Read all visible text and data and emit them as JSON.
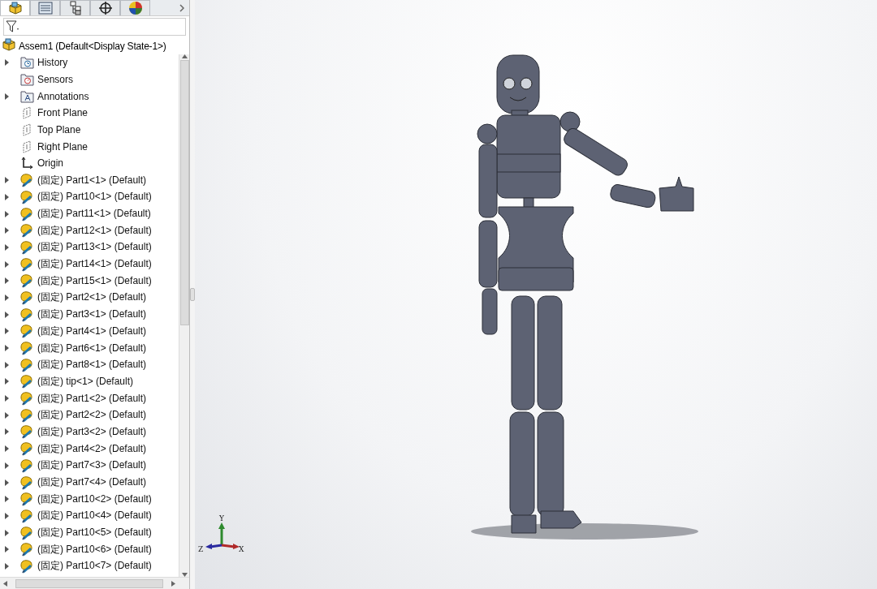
{
  "panel_tabs": [
    {
      "kind": "feature",
      "selected": true
    },
    {
      "kind": "property",
      "selected": false
    },
    {
      "kind": "config",
      "selected": false
    },
    {
      "kind": "dimxpert",
      "selected": false
    },
    {
      "kind": "display",
      "selected": false
    }
  ],
  "root": {
    "label": "Assem1  (Default<Display State-1>)"
  },
  "tree": [
    {
      "kind": "history",
      "label": "History",
      "expandable": true
    },
    {
      "kind": "sensors",
      "label": "Sensors",
      "expandable": false
    },
    {
      "kind": "annotations",
      "label": "Annotations",
      "expandable": true
    },
    {
      "kind": "plane",
      "label": "Front Plane",
      "expandable": false
    },
    {
      "kind": "plane",
      "label": "Top Plane",
      "expandable": false
    },
    {
      "kind": "plane",
      "label": "Right Plane",
      "expandable": false
    },
    {
      "kind": "origin",
      "label": "Origin",
      "expandable": false
    },
    {
      "kind": "part",
      "label": "(固定) Part1<1> (Default)",
      "expandable": true
    },
    {
      "kind": "part",
      "label": "(固定) Part10<1> (Default)",
      "expandable": true
    },
    {
      "kind": "part",
      "label": "(固定) Part11<1> (Default)",
      "expandable": true
    },
    {
      "kind": "part",
      "label": "(固定) Part12<1> (Default)",
      "expandable": true
    },
    {
      "kind": "part",
      "label": "(固定) Part13<1> (Default)",
      "expandable": true
    },
    {
      "kind": "part",
      "label": "(固定) Part14<1> (Default)",
      "expandable": true
    },
    {
      "kind": "part",
      "label": "(固定) Part15<1> (Default)",
      "expandable": true
    },
    {
      "kind": "part",
      "label": "(固定) Part2<1> (Default)",
      "expandable": true
    },
    {
      "kind": "part",
      "label": "(固定) Part3<1> (Default)",
      "expandable": true
    },
    {
      "kind": "part",
      "label": "(固定) Part4<1> (Default)",
      "expandable": true
    },
    {
      "kind": "part",
      "label": "(固定) Part6<1> (Default)",
      "expandable": true
    },
    {
      "kind": "part",
      "label": "(固定) Part8<1> (Default)",
      "expandable": true
    },
    {
      "kind": "part",
      "label": "(固定) tip<1> (Default)",
      "expandable": true
    },
    {
      "kind": "part",
      "label": "(固定) Part1<2> (Default)",
      "expandable": true
    },
    {
      "kind": "part",
      "label": "(固定) Part2<2> (Default)",
      "expandable": true
    },
    {
      "kind": "part",
      "label": "(固定) Part3<2> (Default)",
      "expandable": true
    },
    {
      "kind": "part",
      "label": "(固定) Part4<2> (Default)",
      "expandable": true
    },
    {
      "kind": "part",
      "label": "(固定) Part7<3> (Default)",
      "expandable": true
    },
    {
      "kind": "part",
      "label": "(固定) Part7<4> (Default)",
      "expandable": true
    },
    {
      "kind": "part",
      "label": "(固定) Part10<2> (Default)",
      "expandable": true
    },
    {
      "kind": "part",
      "label": "(固定) Part10<4> (Default)",
      "expandable": true
    },
    {
      "kind": "part",
      "label": "(固定) Part10<5> (Default)",
      "expandable": true
    },
    {
      "kind": "part",
      "label": "(固定) Part10<6> (Default)",
      "expandable": true
    },
    {
      "kind": "part",
      "label": "(固定) Part10<7> (Default)",
      "expandable": true
    }
  ],
  "triad": {
    "x": "X",
    "y": "Y",
    "z": "Z"
  }
}
